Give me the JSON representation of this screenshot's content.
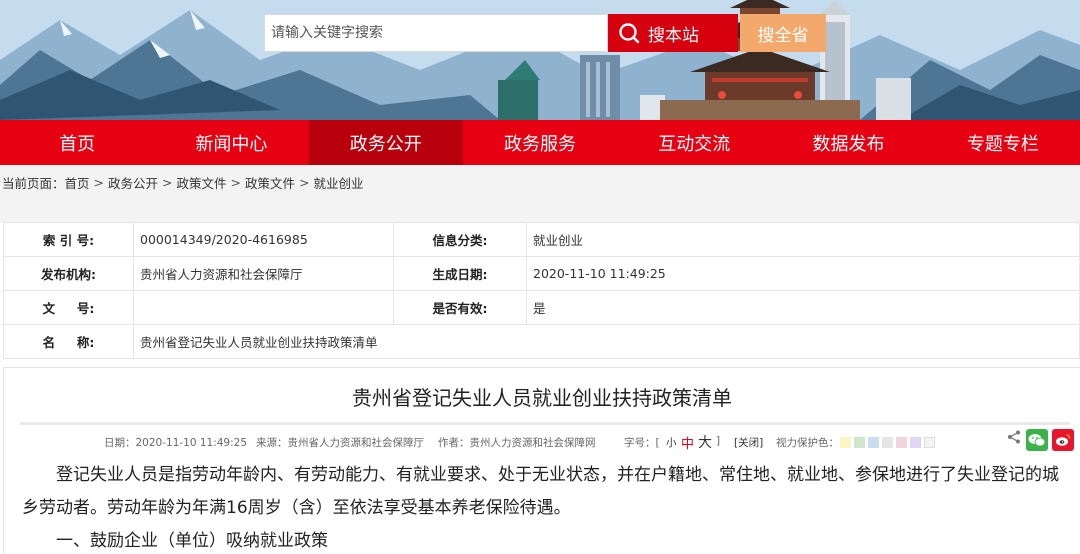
{
  "search": {
    "placeholder": "请输入关键字搜索",
    "site_button": "搜本站",
    "province_button": "搜全省"
  },
  "nav": {
    "items": [
      "首页",
      "新闻中心",
      "政务公开",
      "政务服务",
      "互动交流",
      "数据发布",
      "专题专栏"
    ],
    "active_index": 2
  },
  "breadcrumb": {
    "label": "当前页面：",
    "items": [
      "首页",
      "政务公开",
      "政策文件",
      "政策文件",
      "就业创业"
    ],
    "separator": ">"
  },
  "info": {
    "index_label": "索 引 号:",
    "index_value": "000014349/2020-4616985",
    "category_label": "信息分类:",
    "category_value": "就业创业",
    "publisher_label": "发布机构:",
    "publisher_value": "贵州省人力资源和社会保障厅",
    "date_label": "生成日期:",
    "date_value": "2020-11-10 11:49:25",
    "docno_label": "文     号:",
    "docno_value": "",
    "valid_label": "是否有效:",
    "valid_value": "是",
    "name_label": "名     称:",
    "name_value": "贵州省登记失业人员就业创业扶持政策清单"
  },
  "article": {
    "title": "贵州省登记失业人员就业创业扶持政策清单",
    "meta": {
      "date": "日期：2020-11-10 11:49:25",
      "source": "来源：贵州省人力资源和社会保障厅",
      "author": "作者：贵州人力资源和社会保障网",
      "font_label": "字号：[",
      "font_small": "小",
      "font_mid": "中",
      "font_big": "大",
      "font_close": "]",
      "close": "[关闭]",
      "vision": "视力保护色："
    },
    "swatch_colors": [
      "#fbf5c4",
      "#cfe6c8",
      "#c8dcf2",
      "#e6e6e6",
      "#f2d6de",
      "#e2d4f2",
      "#f4f4f4"
    ],
    "paragraph_1": "登记失业人员是指劳动年龄内、有劳动能力、有就业要求、处于无业状态，并在户籍地、常住地、就业地、参保地进行了失业登记的城乡劳动者。劳动年龄为年满16周岁（含）至依法享受基本养老保险待遇。",
    "paragraph_2": "一、鼓励企业（单位）吸纳就业政策"
  }
}
